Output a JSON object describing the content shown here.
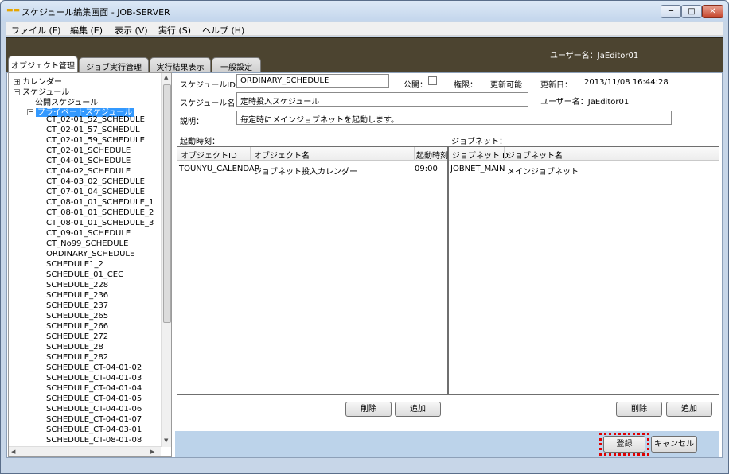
{
  "window": {
    "title": "スケジュール編集画面 - JOB-SERVER",
    "controls": {
      "minimize": "─",
      "maximize": "□",
      "close": "✕"
    }
  },
  "menu": [
    "ファイル (F)",
    "編集 (E)",
    "表示 (V)",
    "実行 (S)",
    "ヘルプ (H)"
  ],
  "header": {
    "user_label": "ユーザー名：JaEditor01"
  },
  "tabs": [
    "オブジェクト管理",
    "ジョブ実行管理",
    "実行結果表示",
    "一般設定"
  ],
  "tree": {
    "calendar": "カレンダー",
    "schedule": "スケジュール",
    "public_schedule": "公開スケジュール",
    "private_schedule": "プライベートスケジュール",
    "items": [
      "CT_02-01_52_SCHEDULE",
      "CT_02-01_57_SCHEDUL",
      "CT_02-01_59_SCHEDULE",
      "CT_02-01_SCHEDULE",
      "CT_04-01_SCHEDULE",
      "CT_04-02_SCHEDULE",
      "CT_04-03_02_SCHEDULE",
      "CT_07-01_04_SCHEDULE",
      "CT_08-01_01_SCHEDULE_1",
      "CT_08-01_01_SCHEDULE_2",
      "CT_08-01_01_SCHEDULE_3",
      "CT_09-01_SCHEDULE",
      "CT_No99_SCHEDULE",
      "ORDINARY_SCHEDULE",
      "SCHEDULE1_2",
      "SCHEDULE_01_CEC",
      "SCHEDULE_228",
      "SCHEDULE_236",
      "SCHEDULE_237",
      "SCHEDULE_265",
      "SCHEDULE_266",
      "SCHEDULE_272",
      "SCHEDULE_28",
      "SCHEDULE_282",
      "SCHEDULE_CT-04-01-02",
      "SCHEDULE_CT-04-01-03",
      "SCHEDULE_CT-04-01-04",
      "SCHEDULE_CT-04-01-05",
      "SCHEDULE_CT-04-01-06",
      "SCHEDULE_CT-04-01-07",
      "SCHEDULE_CT-04-03-01",
      "SCHEDULE_CT-08-01-08"
    ]
  },
  "form": {
    "schedule_id_label": "スケジュールID：",
    "schedule_id_value": "ORDINARY_SCHEDULE",
    "public_label": "公開：",
    "permission_label": "権限：",
    "permission_value": "更新可能",
    "updated_label": "更新日：",
    "updated_value": "2013/11/08 16:44:28",
    "schedule_name_label": "スケジュール名：",
    "schedule_name_value": "定時投入スケジュール",
    "user_label": "ユーザー名：JaEditor01",
    "description_label": "説明：",
    "description_value": "毎定時にメインジョブネットを起動します。"
  },
  "start_times": {
    "label": "起動時刻：",
    "columns": [
      "オブジェクトID",
      "オブジェクト名",
      "起動時刻"
    ],
    "rows": [
      [
        "TOUNYU_CALENDAR",
        "ジョブネット投入カレンダー",
        "09:00"
      ]
    ],
    "delete_button": "削除",
    "add_button": "追加"
  },
  "jobnets": {
    "label": "ジョブネット：",
    "columns": [
      "ジョブネットID",
      "ジョブネット名"
    ],
    "rows": [
      [
        "JOBNET_MAIN",
        "メインジョブネット"
      ]
    ],
    "delete_button": "削除",
    "add_button": "追加"
  },
  "footer": {
    "register_button": "登録",
    "cancel_button": "キャンセル"
  },
  "colors": {
    "header_bg": "#4c4430",
    "selection": "#3399ff",
    "highlight": "#e00000"
  }
}
